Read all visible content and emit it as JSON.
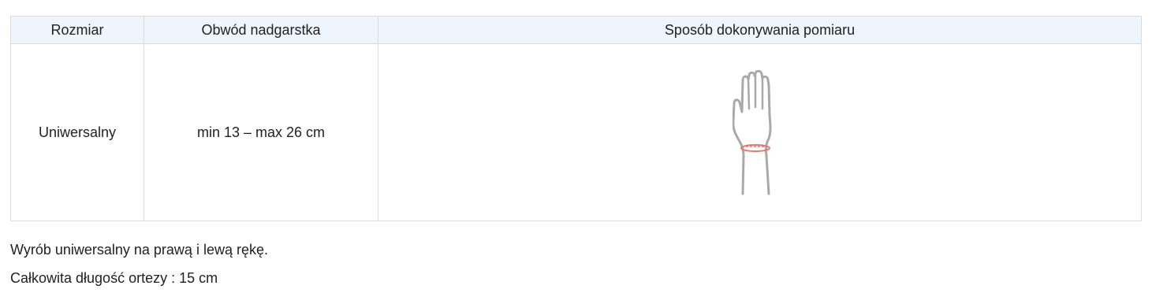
{
  "table": {
    "headers": [
      "Rozmiar",
      "Obwód nadgarstka",
      "Sposób dokonywania pomiaru"
    ],
    "rows": [
      {
        "size": "Uniwersalny",
        "circumference": "min 13 – max 26 cm"
      }
    ],
    "illustration_icon": "wrist-measurement-icon",
    "colors": {
      "header_bg": "#eef5fc",
      "border": "#dcdcdc",
      "hand_stroke": "#a9a9a9",
      "measure_line": "#e8776a"
    }
  },
  "notes": [
    "Wyrób uniwersalny na prawą i lewą rękę.",
    "Całkowita długość ortezy : 15 cm"
  ]
}
